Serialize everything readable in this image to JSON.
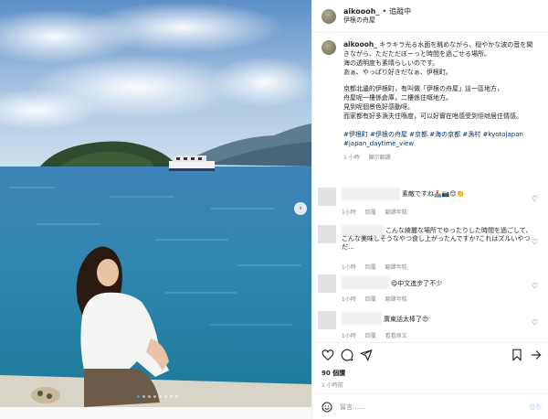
{
  "header": {
    "username": "aikoooh_",
    "separator": "•",
    "follow_label": "追蹤中",
    "location": "伊根の舟屋"
  },
  "caption": {
    "username": "aikoooh_",
    "line1": "キラキラ光る水面を眺めながら、穏やかな波の音を聞きながら、ただただぼーっと時間を過ごせる場所。",
    "line2": "海の透明度も素晴らしいのです。",
    "line3": "あぁ、やっぱり好きだなぁ、伊根町。",
    "zh1": "京都北邊的伊根町，有叫做「伊根の舟屋」這一區地方，",
    "zh2": "舟屋呢一樓係倉庫，二樓係住嘅地方。",
    "zh3": "見到呢個景色好感動呀。",
    "zh4": "而家都有好多漁夫住喺度，可以好實在咁感受到佢哋居住情感。",
    "hashtags": "#伊根町 #伊根の舟屋 #京都 #海の京都 #漁村 #kyotojapan #japan_daytime_view",
    "time": "1 小時",
    "translate": "顯示翻譯"
  },
  "comments": [
    {
      "text": "素敵ですね🚣🏼‍♀️📷😊👏",
      "time": "1小時",
      "reply": "回覆",
      "translate": "翻譯年糕"
    },
    {
      "text": "こんな綺麗な場所でゆったりした時間を過ごして、こんな美味しそうなやつ食し上がったんですか?これはズルいやつだ…",
      "time": "1小時",
      "reply": "回覆",
      "translate": "翻譯年糕"
    },
    {
      "text": "😋中文進步了不少",
      "time": "1小時",
      "reply": "回覆",
      "translate": "翻譯年糕"
    },
    {
      "text": "廣東話太棒了😍",
      "time": "1小時",
      "reply": "回覆",
      "translate": "看看原文"
    }
  ],
  "stats": {
    "likes": "90 個讚",
    "time": "1 小時前"
  },
  "add_comment": {
    "placeholder": "留言……",
    "post_label": "發布"
  },
  "colors": {
    "link": "#00376b",
    "muted": "#8e8e8e",
    "accent": "#3897f0"
  }
}
